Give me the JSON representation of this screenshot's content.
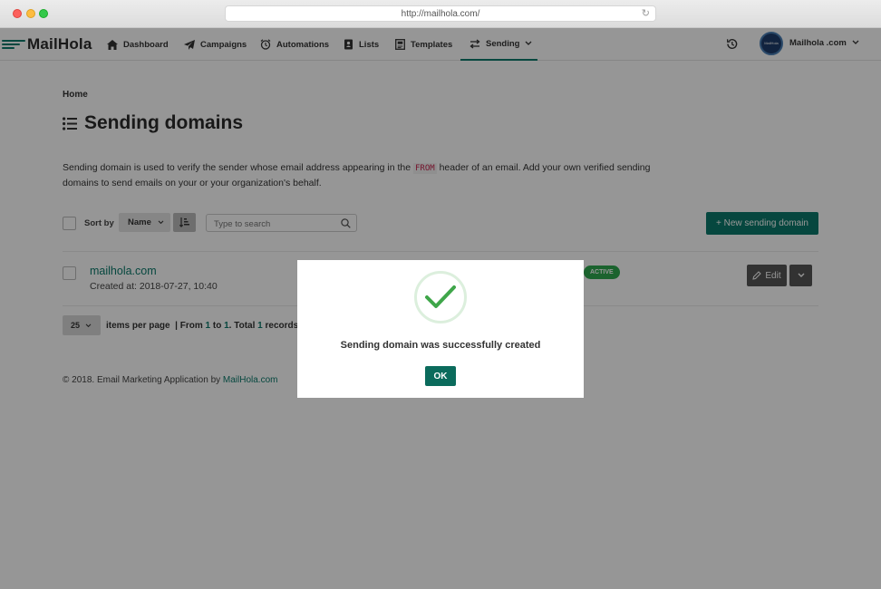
{
  "browser": {
    "url": "http://mailhola.com/"
  },
  "app": {
    "logo": "MailHola"
  },
  "nav": {
    "items": [
      {
        "label": "Dashboard",
        "icon": "home-icon"
      },
      {
        "label": "Campaigns",
        "icon": "paper-plane-icon"
      },
      {
        "label": "Automations",
        "icon": "alarm-clock-icon"
      },
      {
        "label": "Lists",
        "icon": "address-book-icon"
      },
      {
        "label": "Templates",
        "icon": "template-icon"
      },
      {
        "label": "Sending",
        "icon": "exchange-icon",
        "active": true
      }
    ],
    "user_name": "Mailhola .com",
    "avatar_text": "MailHola"
  },
  "page": {
    "breadcrumb": "Home",
    "title": "Sending domains",
    "description_part1": "Sending domain is used to verify the sender whose email address appearing in the ",
    "description_code": "FROM",
    "description_part2": " header of an email. Add your own verified sending domains to send emails on your or your organization's behalf."
  },
  "toolbar": {
    "sort_label": "Sort by",
    "sort_value": "Name",
    "search_placeholder": "Type to search",
    "new_button": "+ New sending domain"
  },
  "domains": [
    {
      "name": "mailhola.com",
      "created": "Created at: 2018-07-27, 10:40",
      "status": "ACTIVE"
    }
  ],
  "row_actions": {
    "edit": "Edit"
  },
  "pager": {
    "per_page": "25",
    "items_per_page": "items per page",
    "sep": "| From",
    "from": "1",
    "to_label": "to",
    "to": "1",
    "total_label": ". Total",
    "total": "1",
    "records": "records"
  },
  "footer": {
    "text": "© 2018. Email Marketing Application by ",
    "link": "MailHola.com"
  },
  "modal": {
    "message": "Sending domain was successfully created",
    "ok": "OK"
  },
  "colors": {
    "accent": "#0b7a6b",
    "active_badge": "#2fa84f",
    "check": "#3fa64a"
  }
}
